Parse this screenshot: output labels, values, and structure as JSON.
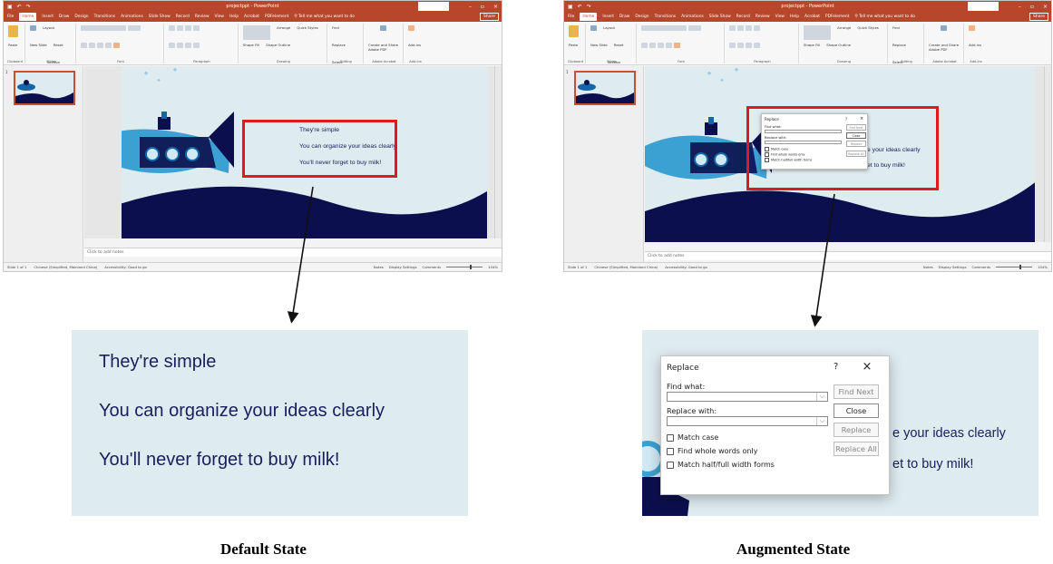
{
  "app": {
    "title": "projectppt - PowerPoint",
    "tabs": [
      "File",
      "Home",
      "Insert",
      "Draw",
      "Design",
      "Transitions",
      "Animations",
      "Slide Show",
      "Record",
      "Review",
      "View",
      "Help",
      "Acrobat",
      "PDFelement"
    ],
    "tell_me": "Tell me what you want to do",
    "share": "Share",
    "ribbon_groups": [
      {
        "label": "Clipboard",
        "items": [
          "Paste"
        ]
      },
      {
        "label": "Slides",
        "items": [
          "New Slide",
          "Layout",
          "Reset",
          "Section"
        ]
      },
      {
        "label": "Font",
        "items": []
      },
      {
        "label": "Paragraph",
        "items": []
      },
      {
        "label": "Drawing",
        "items": [
          "Arrange",
          "Quick Styles",
          "Shape Fill",
          "Shape Outline",
          "Shape Effects"
        ]
      },
      {
        "label": "Editing",
        "items": [
          "Find",
          "Replace",
          "Select"
        ]
      },
      {
        "label": "Adobe Acrobat",
        "items": [
          "Create and Share Adobe PDF"
        ]
      },
      {
        "label": "Add-ins",
        "items": [
          "Add-ins"
        ]
      }
    ],
    "slide_number": "1",
    "notes_placeholder": "Click to add notes",
    "status": {
      "slide_of": "Slide 1 of 1",
      "language": "Chinese (Simplified, Mainland China)",
      "accessibility": "Accessibility: Good to go",
      "notes": "Notes",
      "display_settings": "Display Settings",
      "comments": "Comments",
      "zoom": "104%"
    }
  },
  "slide": {
    "lines": [
      "They're simple",
      "You can organize your ideas clearly",
      "You'll never forget to buy milk!"
    ],
    "partial_lines": [
      "e your ideas clearly",
      "et to buy milk!"
    ]
  },
  "dialog": {
    "title": "Replace",
    "help": "?",
    "close_glyph": "×",
    "find_label": "Find what:",
    "replace_label": "Replace with:",
    "find_value": "",
    "replace_value": "",
    "buttons": {
      "find_next": "Find Next",
      "close": "Close",
      "replace": "Replace",
      "replace_all": "Replace All"
    },
    "checkboxes": [
      "Match case",
      "Find whole words only",
      "Match half/full width forms"
    ]
  },
  "captions": {
    "left": "Default State",
    "right": "Augmented State"
  },
  "colors": {
    "ppt_accent": "#b7472a",
    "highlight": "#e0191e",
    "slide_bg": "#dfecef",
    "text_navy": "#1a2060",
    "wave": "#0c0f4d",
    "sub_blue": "#1466a8"
  }
}
